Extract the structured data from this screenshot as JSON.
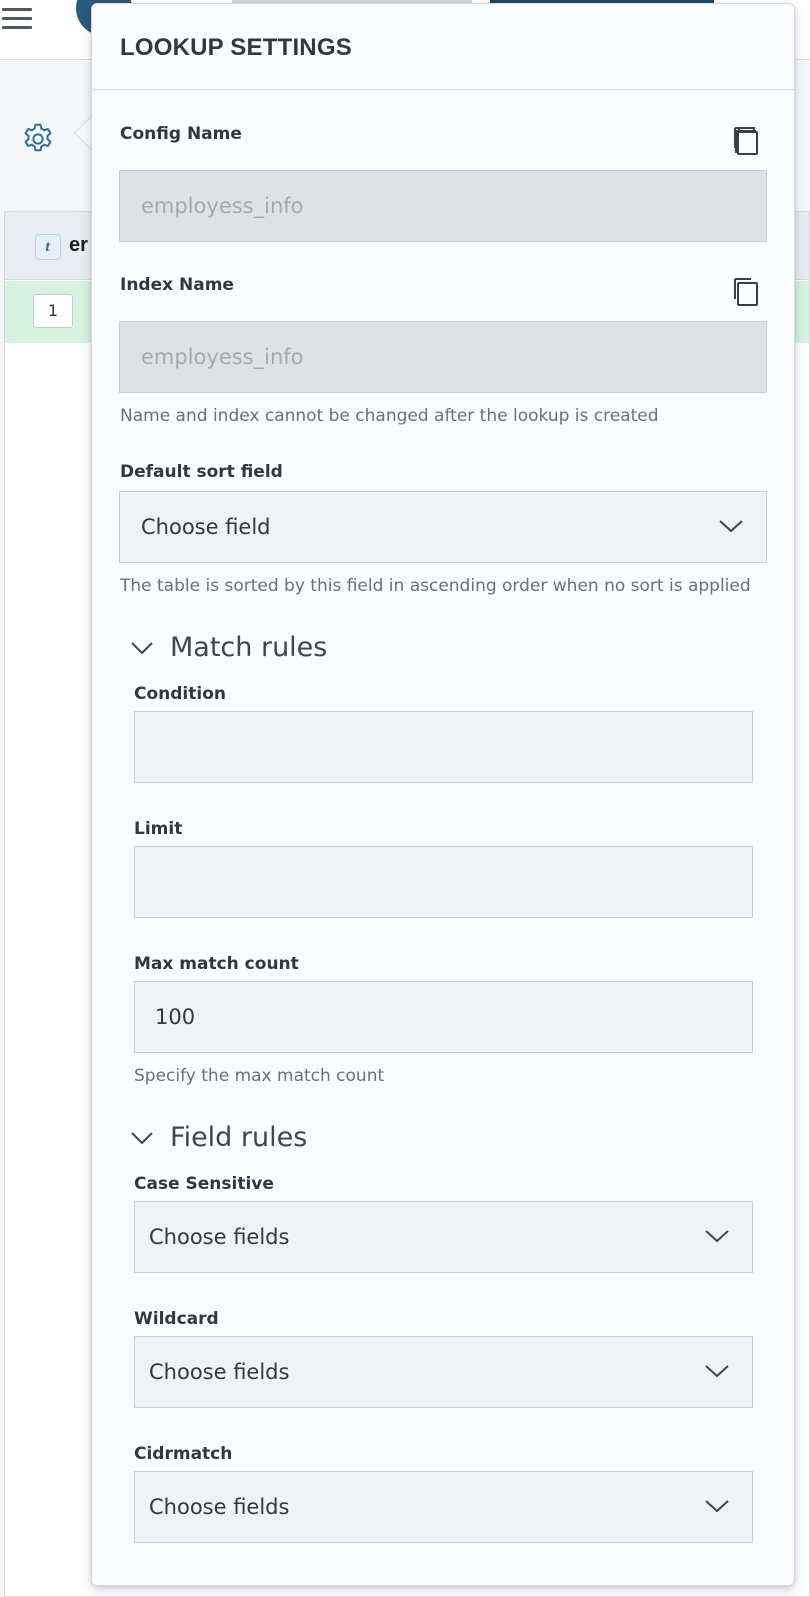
{
  "background": {
    "table": {
      "column_type_badge": "t",
      "column_name": "er",
      "row_number": "1"
    }
  },
  "flyout": {
    "title": "LOOKUP SETTINGS",
    "config_name": {
      "label": "Config Name",
      "value": "employess_info"
    },
    "index_name": {
      "label": "Index Name",
      "value": "employess_info"
    },
    "name_index_help": "Name and index cannot be changed after the lookup is created",
    "default_sort": {
      "label": "Default sort field",
      "value": "Choose field",
      "help": "The table is sorted by this field in ascending order when no sort is applied"
    },
    "match_rules": {
      "title": "Match rules",
      "condition": {
        "label": "Condition",
        "value": ""
      },
      "limit": {
        "label": "Limit",
        "value": ""
      },
      "max_match_count": {
        "label": "Max match count",
        "value": "100",
        "help": "Specify the max match count"
      }
    },
    "field_rules": {
      "title": "Field rules",
      "case_sensitive": {
        "label": "Case Sensitive",
        "value": "Choose fields"
      },
      "wildcard": {
        "label": "Wildcard",
        "value": "Choose fields"
      },
      "cidrmatch": {
        "label": "Cidrmatch",
        "value": "Choose fields"
      }
    }
  },
  "icons": {
    "menu": "hamburger-icon",
    "settings": "gear-icon",
    "copy": "copy-icon",
    "dropdown": "chevron-down-icon"
  },
  "colors": {
    "panel_background": "#fbfcfd",
    "readonly_field": "#dfe1e4",
    "field": "#f1f2f4",
    "row_highlight": "#d8f2e2",
    "avatar": "#2a5b7c"
  }
}
